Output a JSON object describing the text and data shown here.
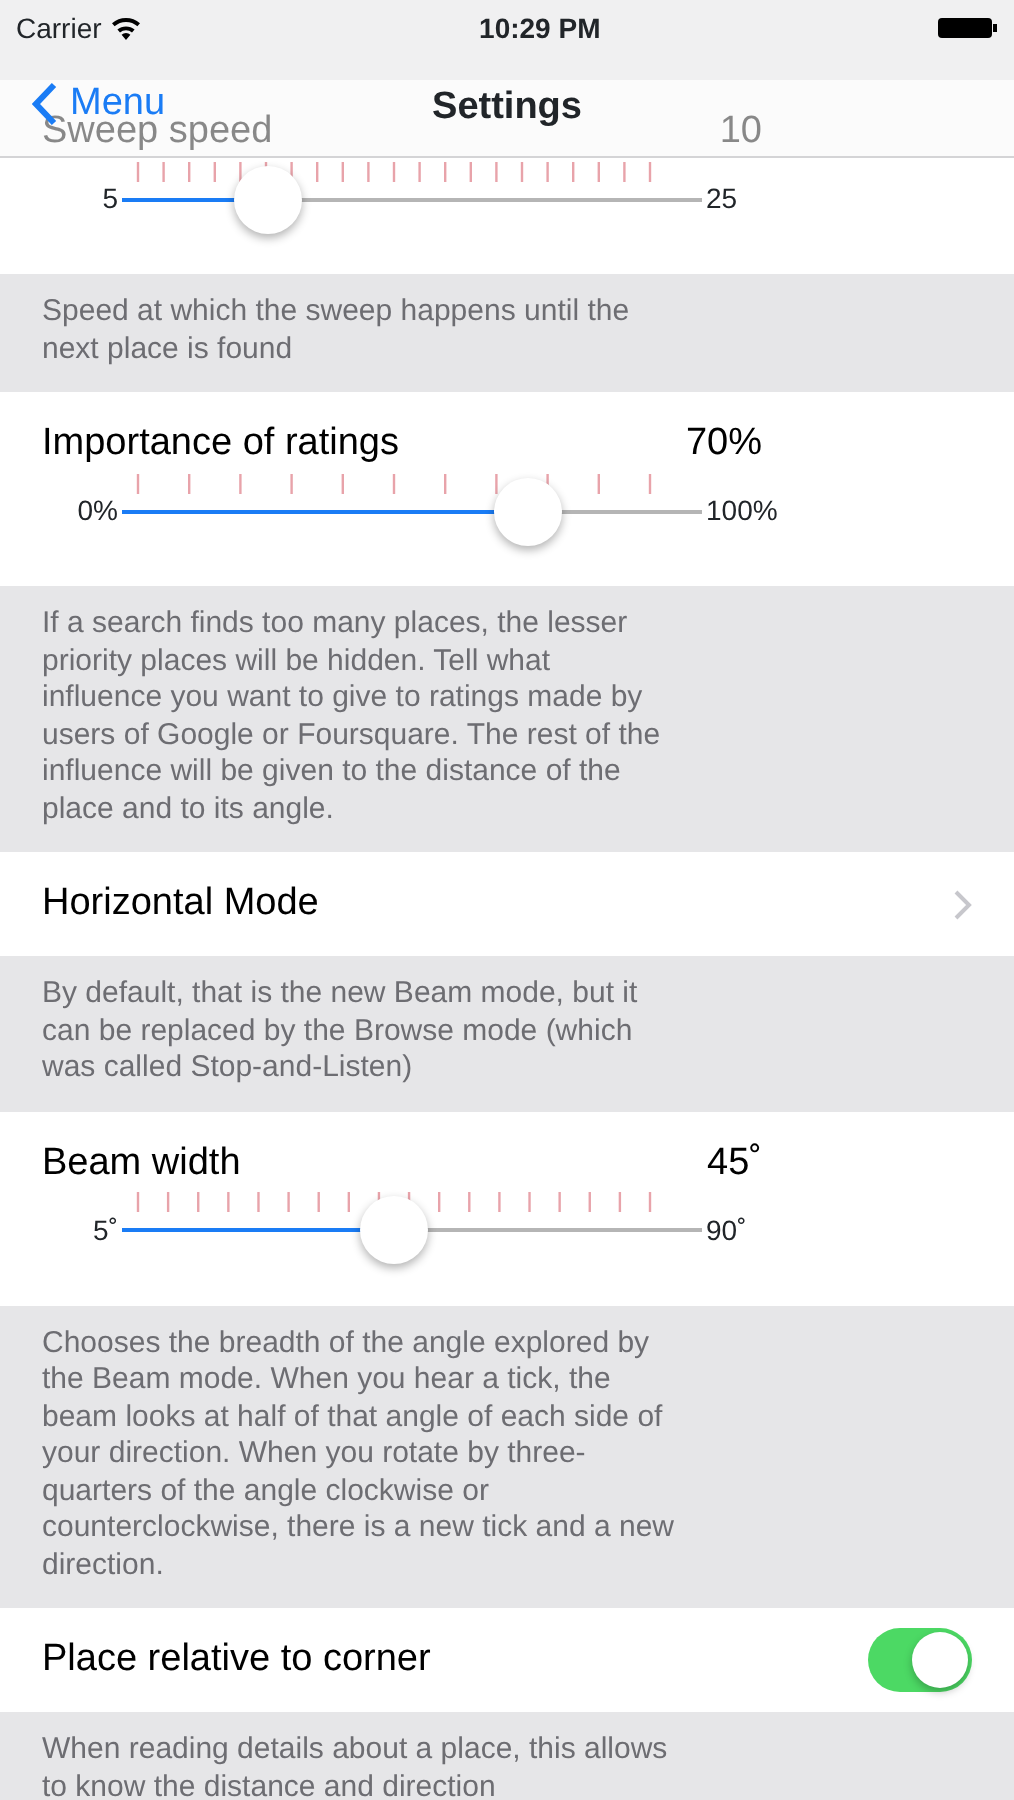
{
  "status_bar": {
    "carrier": "Carrier",
    "time": "10:29 PM"
  },
  "nav_bar": {
    "back": "Menu",
    "title": "Settings"
  },
  "sections": [
    {
      "kind": "slider",
      "title": "Sweep speed",
      "value": "10",
      "min": "5",
      "max": "25",
      "level": 0.25,
      "footer": "Speed at which the sweep happens until the next place is found"
    },
    {
      "kind": "slider",
      "title": "Importance of ratings",
      "value": "70%",
      "min": "0%",
      "max": "100%",
      "level": 0.7,
      "footer": "If a search finds too many places, the lesser priority places will be hidden. Tell what influence you want to give to ratings made by users of Google or Foursquare. The rest of the influence will be given to the distance of the place and to its angle."
    },
    {
      "kind": "link",
      "title": "Horizontal Mode",
      "footer": "By default, that is the new Beam mode, but it can be replaced by the Browse mode (which was called Stop-and-Listen)"
    },
    {
      "kind": "slider",
      "title": "Beam width",
      "value": "45˚",
      "min": "5˚",
      "max": "90˚",
      "level": 0.47,
      "footer": "Chooses the breadth of the angle explored by the Beam mode. When you hear a tick, the beam looks at half of that angle of each side of your direction. When you rotate by three-quarters of the angle clockwise or counterclockwise, there is a new tick and a new direction."
    },
    {
      "kind": "toggle",
      "title": "Place relative to corner",
      "on": true,
      "footer": "When reading details about a place, this allows to know the distance and direction"
    }
  ]
}
